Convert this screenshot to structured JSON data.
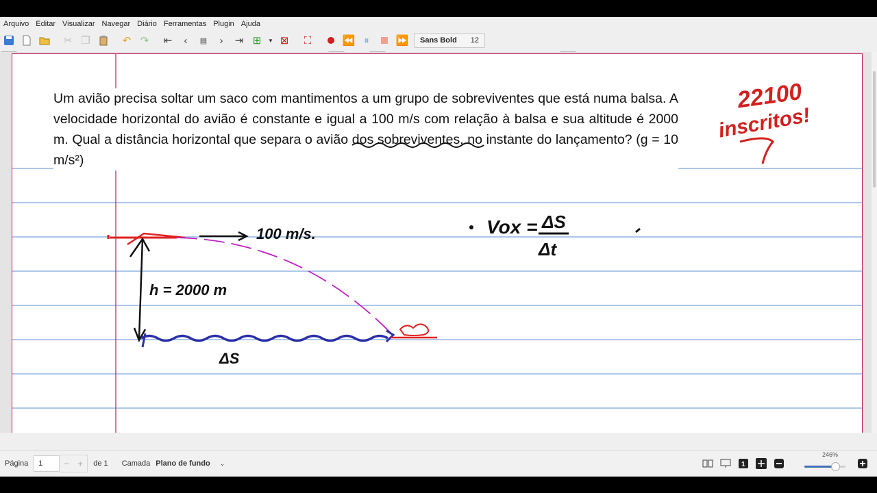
{
  "menu": [
    "Arquivo",
    "Editar",
    "Visualizar",
    "Navegar",
    "Diário",
    "Ferramentas",
    "Plugin",
    "Ajuda"
  ],
  "toolbar": {
    "font_name": "Sans Bold",
    "font_size": "12"
  },
  "palette": [
    "#111111",
    "#1a9b3a",
    "#29c0e0",
    "#2ecc40",
    "#2a2fa8",
    "#888888",
    "#e02020",
    "#d020c0",
    "#ff8c1a",
    "#ffee22",
    "#ffffff",
    "#111111"
  ],
  "document": {
    "question": "Um avião precisa soltar um saco com mantimentos a um grupo de sobreviventes que está numa balsa. A velocidade horizontal do avião é constante e igual a 100 m/s com relação à balsa e sua altitude é 2000 m. Qual a distância horizontal que separa o avião dos sobreviventes, no instante do lançamento? (g = 10 m/s²)",
    "handwriting": {
      "subscribers_count": "22100",
      "subscribers_word": "inscritos!",
      "velocity": "100 m/s.",
      "height": "h = 2000 m",
      "delta_s": "ΔS",
      "formula_lhs": "Vox =",
      "formula_num": "ΔS",
      "formula_den": "Δt"
    }
  },
  "status": {
    "page_label": "Página",
    "page_value": "1",
    "of_label": "de 1",
    "layer_label": "Camada",
    "layer_value": "Plano de fundo",
    "zoom": "246%",
    "zoom_fraction": 0.75
  }
}
